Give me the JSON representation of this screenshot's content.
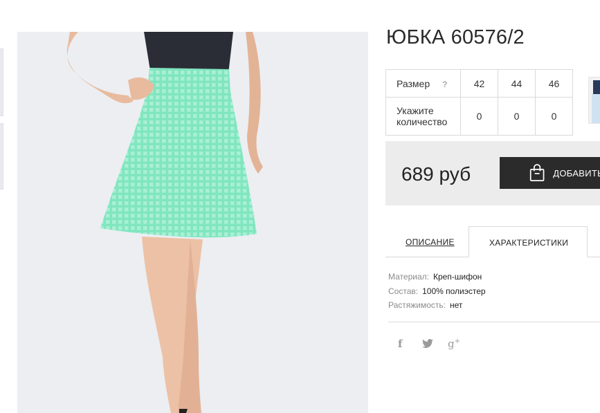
{
  "product": {
    "title": "ЮБКА 60576/2",
    "price": "689 руб",
    "add_to_cart_label": "ДОБАВИТЬ"
  },
  "size_table": {
    "size_label": "Размер",
    "help_label": "?",
    "sizes": [
      "42",
      "44",
      "46"
    ],
    "quantity_label": "Укажите количество",
    "quantities": [
      "0",
      "0",
      "0"
    ]
  },
  "tabs": [
    {
      "label": "ОПИСАНИЕ",
      "active": false
    },
    {
      "label": "ХАРАКТЕРИСТИКИ",
      "active": true
    }
  ],
  "characteristics": [
    {
      "key": "Материал:",
      "value": "Креп-шифон"
    },
    {
      "key": "Состав:",
      "value": "100% полиэстер"
    },
    {
      "key": "Растяжимость:",
      "value": "нет"
    }
  ],
  "social": [
    {
      "icon": "facebook-icon",
      "glyph": "f"
    },
    {
      "icon": "twitter-icon",
      "glyph": "🐦"
    },
    {
      "icon": "google-plus-icon",
      "glyph": "g",
      "sup": "+"
    }
  ],
  "colors": {
    "skirt": "#7fe3bd",
    "button_bg": "#2b2b2b",
    "price_box_bg": "#ececec"
  }
}
